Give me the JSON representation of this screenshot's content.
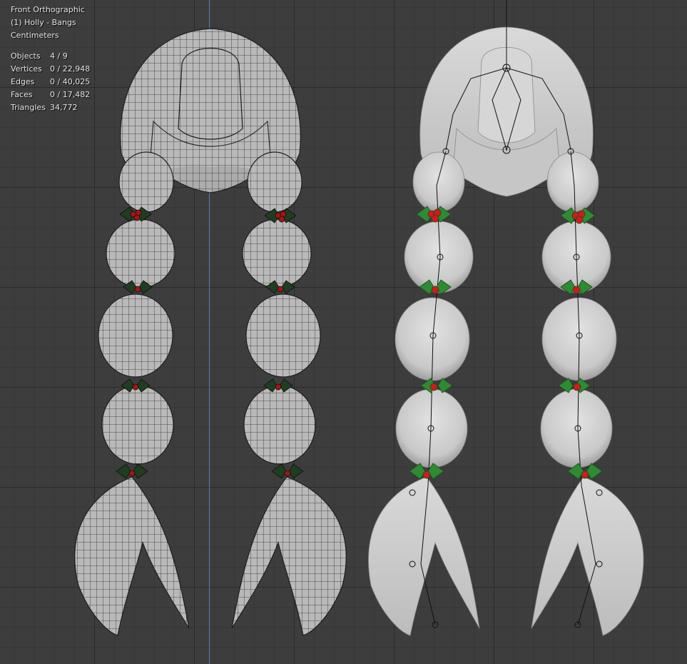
{
  "viewport": {
    "view_name": "Front Orthographic",
    "active_object": "(1) Holly - Bangs",
    "units": "Centimeters"
  },
  "stats": [
    {
      "label": "Objects",
      "value": "4 / 9"
    },
    {
      "label": "Vertices",
      "value": "0 / 22,948"
    },
    {
      "label": "Edges",
      "value": "0 / 40,025"
    },
    {
      "label": "Faces",
      "value": "0 / 17,482"
    },
    {
      "label": "Triangles",
      "value": "34,772"
    }
  ],
  "colors": {
    "viewport_bg": "#3d3d3d",
    "axis_z": "#5a7fb3",
    "hair_wire": "#bdbdbd",
    "hair_solid": "#cfcfcf",
    "holly_leaf": "#2f7d33",
    "holly_berry": "#c01818",
    "bone": "#111111"
  }
}
